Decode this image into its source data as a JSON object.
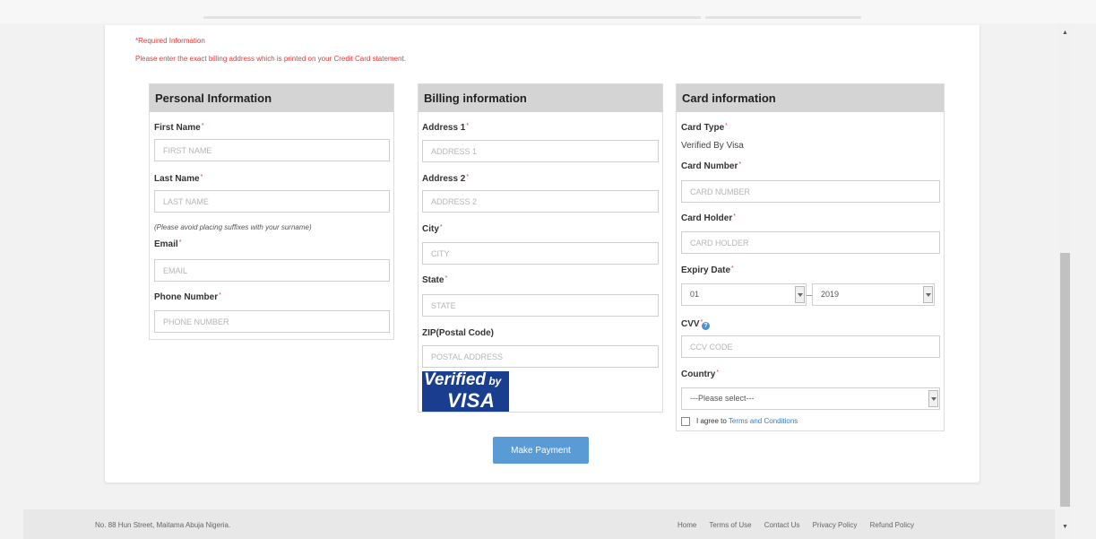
{
  "notes": {
    "required": "*Required Information",
    "billing_instruction": "Please enter the exact billing address which is printed on your Credit Card statement."
  },
  "personal": {
    "title": "Personal Information",
    "first_name_label": "First Name",
    "first_name_placeholder": "FIRST NAME",
    "last_name_label": "Last Name",
    "last_name_placeholder": "LAST NAME",
    "surname_hint": "(Please avoid placing suffixes with your surname)",
    "email_label": "Email",
    "email_placeholder": "EMAIL",
    "phone_label": "Phone Number",
    "phone_placeholder": "PHONE NUMBER"
  },
  "billing": {
    "title": "Billing information",
    "address1_label": "Address 1",
    "address1_placeholder": "ADDRESS 1",
    "address2_label": "Address 2",
    "address2_placeholder": "ADDRESS 2",
    "city_label": "City",
    "city_placeholder": "CITY",
    "state_label": "State",
    "state_placeholder": "STATE",
    "zip_label": "ZIP(Postal Code)",
    "zip_placeholder": "POSTAL ADDRESS",
    "visa_logo_line1": "Verified",
    "visa_logo_by": "by",
    "visa_logo_line2": "VISA"
  },
  "card": {
    "title": "Card information",
    "card_type_label": "Card Type",
    "card_type_value": "Verified By Visa",
    "card_number_label": "Card Number",
    "card_number_placeholder": "CARD NUMBER",
    "card_holder_label": "Card Holder",
    "card_holder_placeholder": "CARD HOLDER",
    "expiry_label": "Expiry Date",
    "expiry_month": "01",
    "expiry_year": "2019",
    "cvv_label": "CVV",
    "cvv_placeholder": "CCV CODE",
    "country_label": "Country",
    "country_value": "---Please select---",
    "terms_prefix": "I agree to",
    "terms_link": "Terms and Conditions"
  },
  "actions": {
    "pay_label": "Make Payment"
  },
  "footer": {
    "address": "No. 88 Hun Street, Maitama Abuja Nigeria.",
    "links": [
      "Home",
      "Terms of Use",
      "Contact Us",
      "Privacy Policy",
      "Refund Policy"
    ]
  },
  "colors": {
    "required": "#e53935",
    "header_bg": "#d4d4d4",
    "button": "#5b9bd5",
    "link": "#3b7dc4",
    "visa_blue": "#1a3e8f"
  },
  "icons": {
    "cvv_help": "info-icon",
    "scroll_up": "chevron-up-icon",
    "scroll_down": "chevron-down-icon"
  }
}
